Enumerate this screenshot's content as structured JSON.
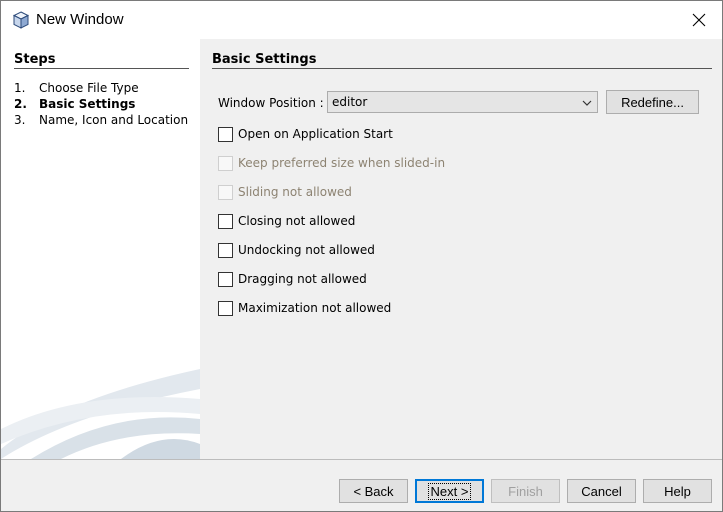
{
  "window": {
    "title": "New Window",
    "icon": "cube-icon",
    "close_icon": "close-icon"
  },
  "steps": {
    "title": "Steps",
    "items": [
      {
        "num": "1.",
        "label": "Choose File Type",
        "current": false
      },
      {
        "num": "2.",
        "label": "Basic Settings",
        "current": true
      },
      {
        "num": "3.",
        "label": "Name, Icon and Location",
        "current": false
      }
    ]
  },
  "panel": {
    "title": "Basic Settings",
    "window_position": {
      "label": "Window Position :",
      "value": "editor"
    },
    "redefine_label": "Redefine...",
    "options": [
      {
        "label": "Open on Application Start",
        "checked": false,
        "enabled": true
      },
      {
        "label": "Keep preferred size when slided-in",
        "checked": false,
        "enabled": false
      },
      {
        "label": "Sliding not allowed",
        "checked": false,
        "enabled": false
      },
      {
        "label": "Closing not allowed",
        "checked": false,
        "enabled": true
      },
      {
        "label": "Undocking not allowed",
        "checked": false,
        "enabled": true
      },
      {
        "label": "Dragging not allowed",
        "checked": false,
        "enabled": true
      },
      {
        "label": "Maximization not allowed",
        "checked": false,
        "enabled": true
      }
    ]
  },
  "footer": {
    "back_label": "< Back",
    "next_label": "Next >",
    "finish_label": "Finish",
    "cancel_label": "Cancel",
    "help_label": "Help"
  },
  "colors": {
    "panel_bg": "#f0f0f0",
    "disabled_text": "#8d8372",
    "default_button_border": "#0078d7"
  }
}
